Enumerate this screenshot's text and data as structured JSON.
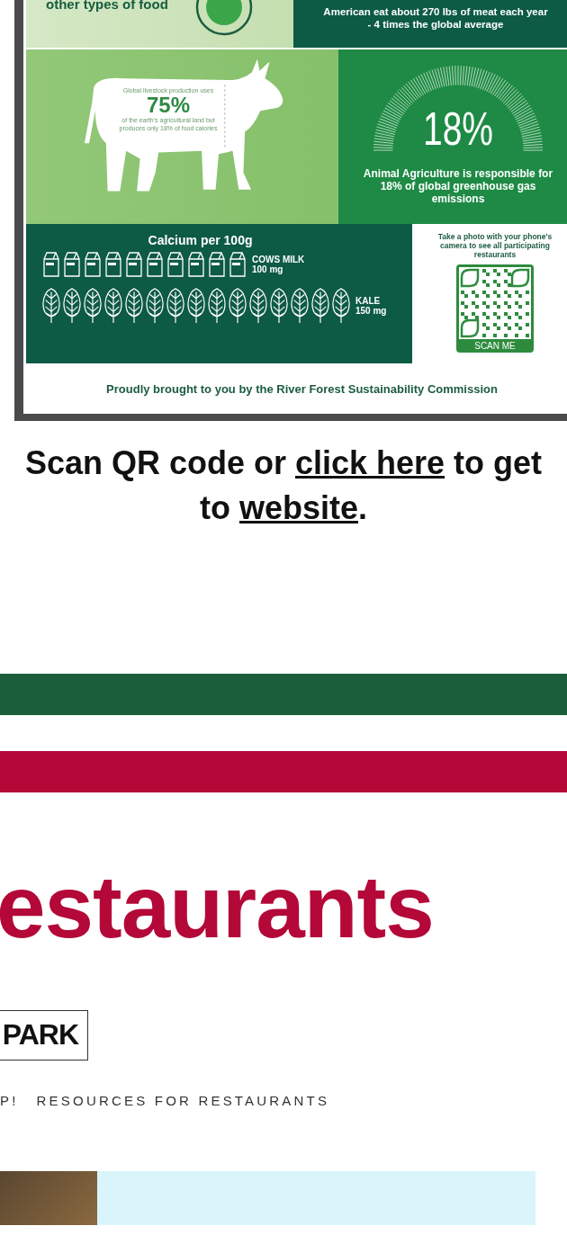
{
  "infographic": {
    "food_panel": {
      "text": "other types of food"
    },
    "meat_panel": {
      "text": "American eat about 270 lbs of meat each year - 4 times the global average"
    },
    "land_panel": {
      "intro": "Global livestock production uses",
      "figure": "75%",
      "detail": "of the earth's agricultural land but produces only 18% of food calories"
    },
    "emissions_panel": {
      "figure": "18%",
      "text": "Animal Agriculture is responsible for 18% of global greenhouse gas emissions"
    },
    "calcium_panel": {
      "title": "Calcium per 100g",
      "rows": [
        {
          "kind": "milk",
          "name": "COWS MILK",
          "amount": "100 mg"
        },
        {
          "kind": "kale",
          "name": "KALE",
          "amount": "150 mg"
        }
      ]
    },
    "qr_panel": {
      "text": "Take a photo with your phone's camera to see all participating restaurants",
      "button": "SCAN ME"
    },
    "footer": "Proudly brought to you by the River Forest Sustainability Commission"
  },
  "scan_note": [
    {
      "kind": "text",
      "text": "Scan QR code or "
    },
    {
      "kind": "link",
      "text": "click here"
    },
    {
      "kind": "text",
      "text": " to get to "
    },
    {
      "kind": "link",
      "text": "website"
    },
    {
      "kind": "text",
      "text": "."
    }
  ],
  "section_heading": "estaurants",
  "logo": "PARK",
  "nav": [
    {
      "label": "P!"
    },
    {
      "label": "RESOURCES FOR RESTAURANTS"
    }
  ]
}
